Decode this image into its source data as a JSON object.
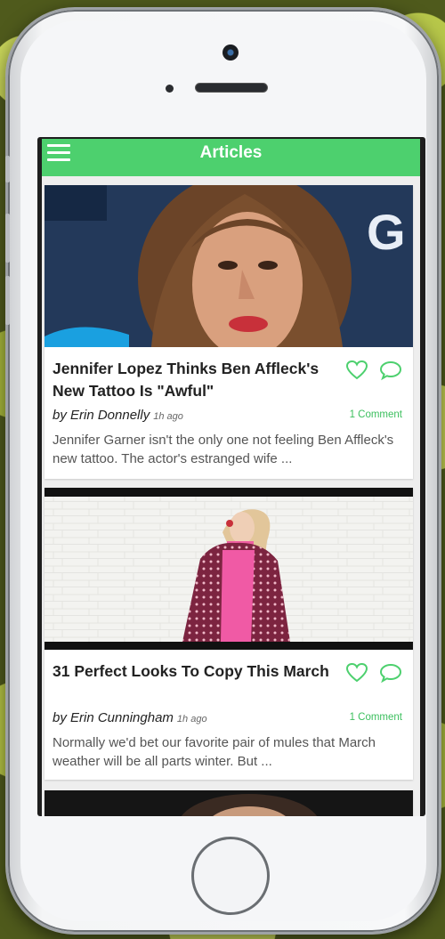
{
  "app": {
    "title": "Articles",
    "accent_color": "#4dd06e",
    "link_color": "#3cbf5e"
  },
  "articles": [
    {
      "title": "Jennifer Lopez Thinks Ben Affleck's New Tattoo Is \"Awful\"",
      "author": "by Erin Donnelly",
      "time": "1h ago",
      "comments": "1 Comment",
      "excerpt": "Jennifer Garner isn't the only one not feeling Ben Affleck's new tattoo. The actor's estranged wife ...",
      "image_text": "G"
    },
    {
      "title": "31 Perfect Looks To Copy This March",
      "author": "by Erin Cunningham",
      "time": "1h ago",
      "comments": "1 Comment",
      "excerpt": "Normally we'd bet our favorite pair of mules that March weather will be all parts winter. But ..."
    }
  ],
  "icons": {
    "menu": "hamburger-menu-icon",
    "like": "heart-icon",
    "comment": "speech-bubble-icon"
  }
}
